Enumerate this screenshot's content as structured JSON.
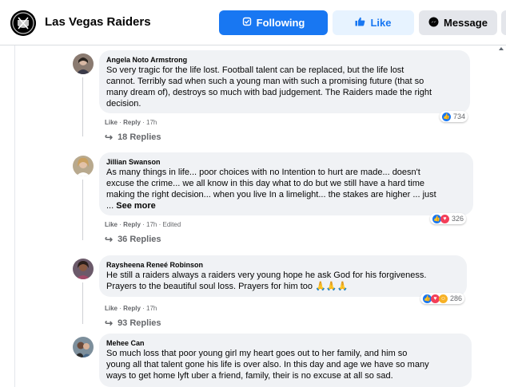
{
  "header": {
    "page_name": "Las Vegas Raiders",
    "following_label": "Following",
    "like_label": "Like",
    "message_label": "Message"
  },
  "colors": {
    "primary": "#1877f2",
    "bubble": "#f0f2f5",
    "secondary_text": "#65676b"
  },
  "comments": [
    {
      "author": "Angela Noto Armstrong",
      "text": "So very tragic for the life lost. Football talent can be replaced, but the life lost\ncannot. Terribly sad when such a young man with such a promising future (that so\nmany dream of), destroys so much with bad judgement. The Raiders made the right\ndecision.",
      "reaction_count": "734",
      "like": "Like",
      "reply": "Reply",
      "time": "17h",
      "replies": "18 Replies"
    },
    {
      "author": "Jillian Swanson",
      "text": "As many things in life... poor choices with no Intention to hurt are made... doesn't\nexcuse the crime... we all know in this day what to do but we still have a hard time\nmaking the right decision... when you live In a limelight... the stakes are higher ... just\n... ",
      "see_more": "See more",
      "reaction_count": "326",
      "like": "Like",
      "reply": "Reply",
      "time": "17h",
      "edited": "Edited",
      "replies": "36 Replies"
    },
    {
      "author": "Raysheena Reneé Robinson",
      "text": "He still a raiders always a raiders very young hope he ask God for his forgiveness.\nPrayers to the beautiful soul loss. Prayers for him too 🙏🙏🙏",
      "reaction_count": "286",
      "like": "Like",
      "reply": "Reply",
      "time": "17h",
      "replies": "93 Replies"
    },
    {
      "author": "Mehee Can",
      "text": "So much loss that poor young girl my heart goes out to her family, and him so\nyoung all that talent gone his life is over also. In this day and age we have so many\nways to get home lyft uber a friend, family, their is no excuse at all so sad."
    }
  ]
}
